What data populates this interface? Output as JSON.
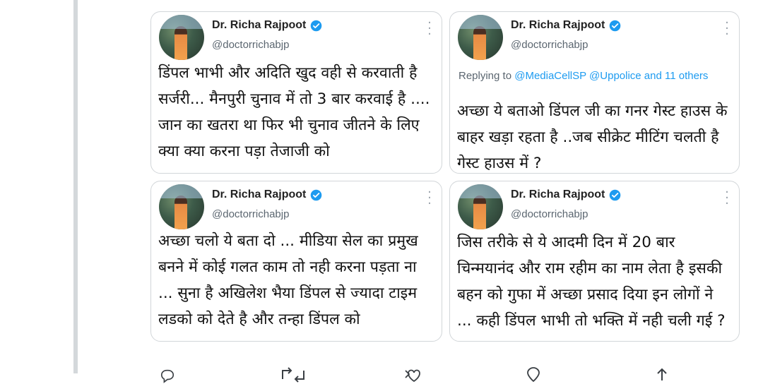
{
  "tweets": [
    {
      "name": "Dr. Richa Rajpoot",
      "handle": "@doctorrichabjp",
      "text": "डिंपल भाभी और अदिति खुद वही से करवाती है सर्जरी... मैनपुरी चुनाव में तो 3 बार करवाई है .... जान का खतरा था फिर भी चुनाव जीतने के लिए क्या क्या करना पड़ा तेजाजी को"
    },
    {
      "name": "Dr. Richa Rajpoot",
      "handle": "@doctorrichabjp",
      "reply_prefix": "Replying to ",
      "reply_mentions": "@MediaCellSP @Uppolice",
      "reply_suffix": " and 11 others",
      "text": "अच्छा ये बताओ डिंपल जी का गनर गेस्ट हाउस के बाहर खड़ा रहता है ..जब सीक्रेट मीटिंग चलती है गेस्ट हाउस में ?"
    },
    {
      "name": "Dr. Richa Rajpoot",
      "handle": "@doctorrichabjp",
      "text": "अच्छा चलो ये बता दो ... मीडिया सेल का प्रमुख बनने में कोई गलत काम तो नही करना पड़ता ना ... सुना है अखिलेश भैया डिंपल से ज्यादा टाइम लडको को देते है और तन्हा डिंपल को"
    },
    {
      "name": "Dr. Richa Rajpoot",
      "handle": "@doctorrichabjp",
      "text": "जिस तरीके से ये आदमी दिन में 20 बार चिन्मयानंद और राम रहीम का नाम लेता है इसकी बहन को गुफा में अच्छा प्रसाद दिया इन लोगों ने ... कही डिंपल भाभी तो भक्ति में नही चली गई ?"
    }
  ],
  "icons": {
    "verified": "verified-badge-icon",
    "more": "more-options-icon",
    "reply": "reply-icon",
    "retweet": "retweet-icon",
    "like": "like-icon",
    "share": "share-icon"
  },
  "colors": {
    "verified": "#1d9bf0",
    "mention": "#1d9bf0",
    "card_border": "#d2d6d9",
    "secondary_text": "#5b6670"
  }
}
